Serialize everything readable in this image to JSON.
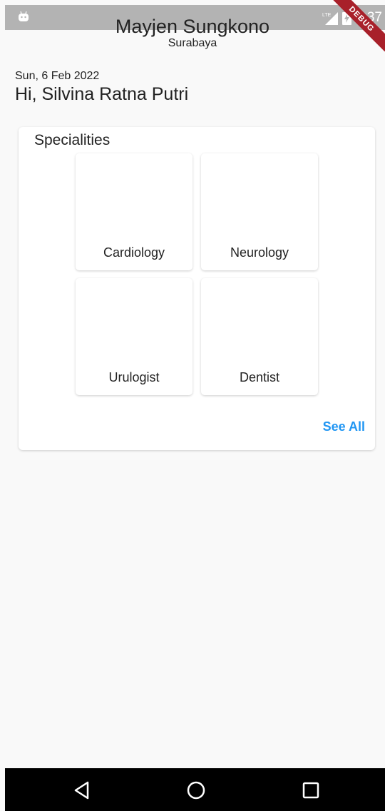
{
  "status_bar": {
    "time": "5:37",
    "network_label": "LTE",
    "debug_label": "DEBUG",
    "left_icon": "android-icon",
    "signal_icon": "signal-icon",
    "battery_icon": "battery-charging-icon"
  },
  "header": {
    "title": "Mayjen Sungkono",
    "subtitle": "Surabaya"
  },
  "greeting": {
    "date": "Sun, 6 Feb 2022",
    "hello": "Hi, Silvina Ratna Putri"
  },
  "specialities": {
    "title": "Specialities",
    "items": [
      {
        "label": "Cardiology"
      },
      {
        "label": "Neurology"
      },
      {
        "label": "Urulogist"
      },
      {
        "label": "Dentist"
      }
    ],
    "see_all": "See All"
  },
  "colors": {
    "accent": "#2196f3",
    "status_bar": "#b3b3b3",
    "debug_ribbon": "#a8202a",
    "background": "#f9f9f9"
  },
  "nav": {
    "back_icon": "back-triangle-icon",
    "home_icon": "home-circle-icon",
    "recents_icon": "recents-square-icon"
  }
}
